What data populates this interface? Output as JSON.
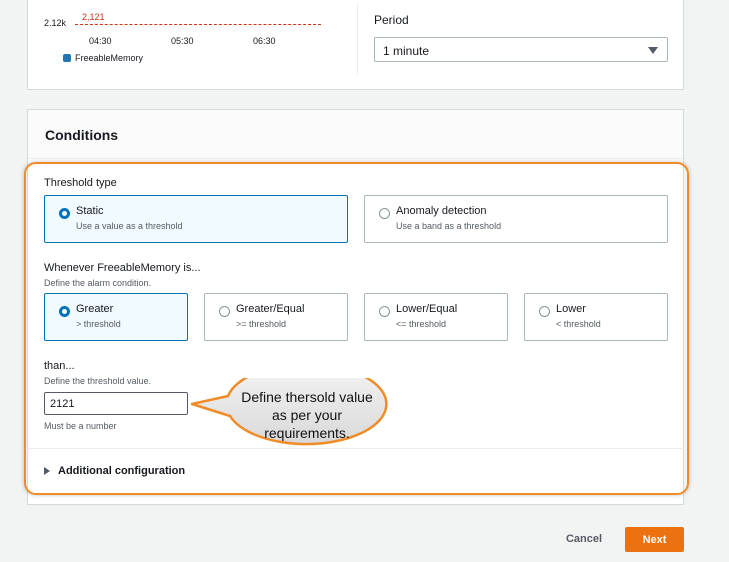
{
  "chart": {
    "y_label": "2.12k",
    "threshold_label": "2,121",
    "x_ticks": [
      "04:30",
      "05:30",
      "06:30"
    ],
    "legend": "FreeableMemory",
    "legend_color": "#1f77b4",
    "threshold_color": "#d13212"
  },
  "period": {
    "label": "Period",
    "value": "1 minute"
  },
  "conditions": {
    "title": "Conditions",
    "threshold_type": {
      "label": "Threshold type",
      "options": [
        {
          "title": "Static",
          "subtitle": "Use a value as a threshold",
          "selected": true
        },
        {
          "title": "Anomaly detection",
          "subtitle": "Use a band as a threshold",
          "selected": false
        }
      ]
    },
    "whenever": {
      "label": "Whenever FreeableMemory is...",
      "description": "Define the alarm condition.",
      "options": [
        {
          "title": "Greater",
          "subtitle": "> threshold",
          "selected": true
        },
        {
          "title": "Greater/Equal",
          "subtitle": ">= threshold",
          "selected": false
        },
        {
          "title": "Lower/Equal",
          "subtitle": "<= threshold",
          "selected": false
        },
        {
          "title": "Lower",
          "subtitle": "< threshold",
          "selected": false
        }
      ]
    },
    "than": {
      "label": "than...",
      "description": "Define the threshold value.",
      "value": "2121",
      "hint": "Must be a number"
    },
    "additional_configuration": "Additional configuration"
  },
  "callout": {
    "text": "Define thersold value as per your requirements."
  },
  "footer": {
    "cancel": "Cancel",
    "next": "Next"
  },
  "colors": {
    "accent": "#ec7211",
    "selected_border": "#0073bb",
    "highlight": "#f08c27"
  }
}
